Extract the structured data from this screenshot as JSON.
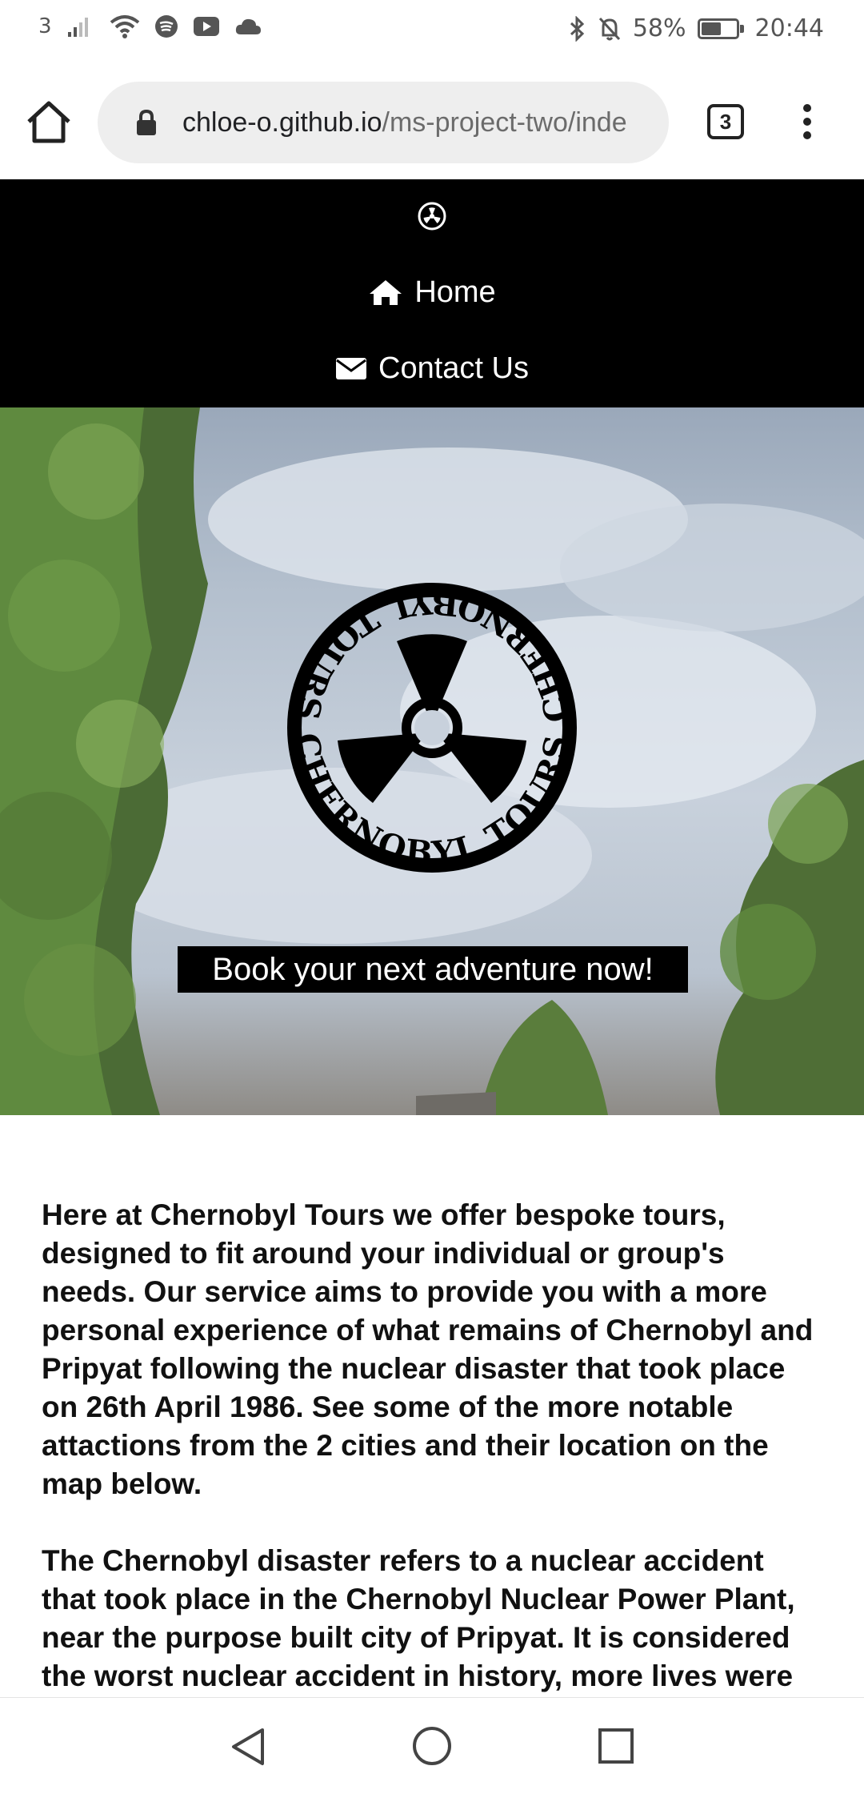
{
  "status_bar": {
    "carrier": "3",
    "battery_percent": "58%",
    "battery_level": 0.58,
    "time": "20:44",
    "icons": [
      "signal-icon",
      "wifi-icon",
      "spotify-icon",
      "youtube-icon",
      "cloud-icon",
      "bluetooth-icon",
      "bell-off-icon",
      "battery-icon"
    ]
  },
  "browser": {
    "url_domain": "chloe-o.github.io",
    "url_path": "/ms-project-two/inde",
    "tab_count": "3"
  },
  "nav": {
    "logo_icon": "radiation-icon",
    "home_label": "Home",
    "home_icon": "home-icon",
    "contact_label": "Contact Us",
    "contact_icon": "envelope-icon"
  },
  "hero": {
    "logo_text": "CHERNOBYL TOURS",
    "cta_label": "Book your next adventure now!"
  },
  "content": {
    "paragraph_1": "Here at Chernobyl Tours we offer bespoke tours, designed to fit around your individual or group's needs. Our service aims to provide you with a more personal experience of what remains of Chernobyl and Pripyat following the nuclear disaster that took place on 26th April 1986. See some of the more notable attactions from the 2 cities and their location on the map below.",
    "paragraph_2": "The Chernobyl disaster refers to a nuclear accident that took place in the Chernobyl Nuclear Power Plant, near the purpose built city of Pripyat. It is considered the worst nuclear accident in history, more lives were"
  },
  "colors": {
    "nav_background": "#000000",
    "nav_text": "#ffffff",
    "urlbar_background": "#eeeeee",
    "cta_background": "#000000"
  }
}
